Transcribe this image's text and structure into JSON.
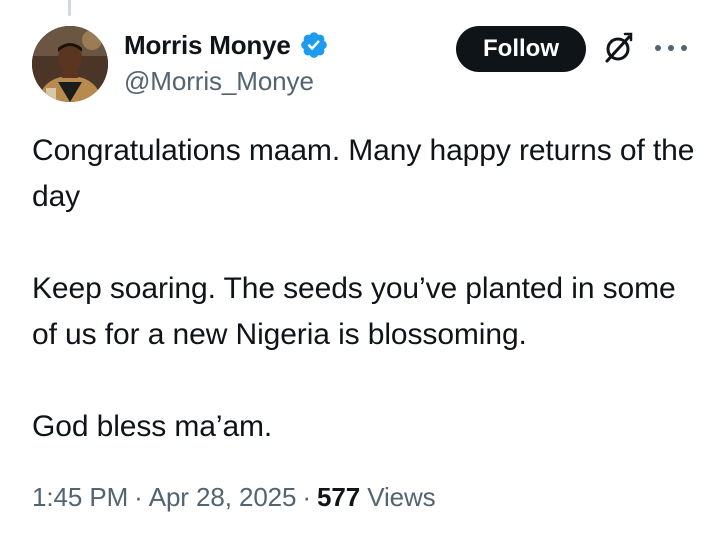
{
  "author": {
    "display_name": "Morris Monye",
    "handle": "@Morris_Monye",
    "verified": true,
    "verified_color": "#1d9bf0"
  },
  "actions": {
    "follow_label": "Follow"
  },
  "tweet": {
    "paragraphs": [
      "Congratulations maam. Many happy returns of the day",
      "Keep soaring. The seeds you’ve planted in some of us for a new Nigeria is blossoming.",
      "God bless ma’am."
    ]
  },
  "meta": {
    "time": "1:45 PM",
    "separator": "·",
    "date": "Apr 28, 2025",
    "views_count": "577",
    "views_label": "Views"
  },
  "colors": {
    "text": "#0f1419",
    "secondary": "#536471",
    "button_bg": "#0f1419",
    "thread_line": "#cfd9de"
  }
}
